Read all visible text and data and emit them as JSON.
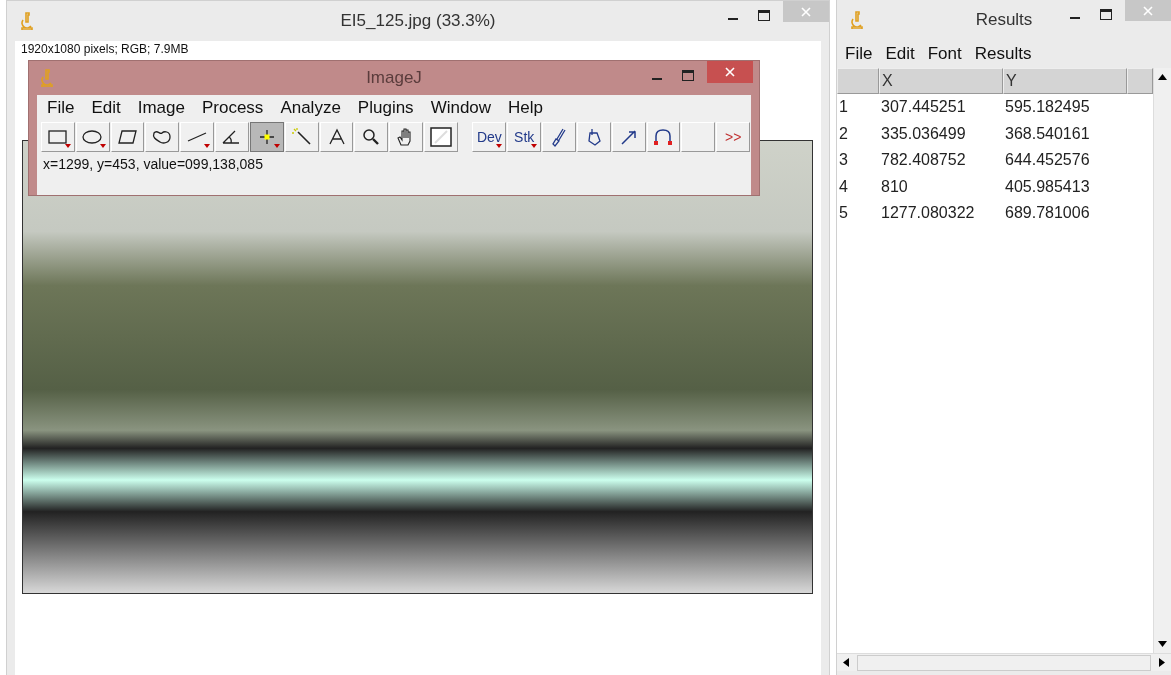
{
  "image_window": {
    "title": "EI5_125.jpg (33.3%)",
    "info": "1920x1080 pixels; RGB; 7.9MB"
  },
  "imagej": {
    "title": "ImageJ",
    "menu": [
      "File",
      "Edit",
      "Image",
      "Process",
      "Analyze",
      "Plugins",
      "Window",
      "Help"
    ],
    "tools": [
      {
        "kind": "rect",
        "selected": false,
        "menu": true
      },
      {
        "kind": "oval",
        "selected": false,
        "menu": true
      },
      {
        "kind": "polygon",
        "selected": false,
        "menu": false
      },
      {
        "kind": "freehand",
        "selected": false,
        "menu": false
      },
      {
        "kind": "line",
        "selected": false,
        "menu": true
      },
      {
        "kind": "angle",
        "selected": false,
        "menu": false
      },
      {
        "kind": "point",
        "selected": true,
        "menu": true
      },
      {
        "kind": "wand",
        "selected": false,
        "menu": false
      },
      {
        "kind": "text",
        "selected": false,
        "menu": false
      },
      {
        "kind": "zoom",
        "selected": false,
        "menu": false
      },
      {
        "kind": "hand",
        "selected": false,
        "menu": false
      },
      {
        "kind": "dropper",
        "selected": false,
        "menu": false
      },
      {
        "kind": "gap"
      },
      {
        "kind": "label",
        "label": "Dev",
        "selected": false,
        "menu": true
      },
      {
        "kind": "label",
        "label": "Stk",
        "selected": false,
        "menu": true
      },
      {
        "kind": "brush",
        "selected": false,
        "menu": false
      },
      {
        "kind": "flood",
        "selected": false,
        "menu": false
      },
      {
        "kind": "arrow",
        "selected": false,
        "menu": false
      },
      {
        "kind": "curve",
        "selected": false,
        "menu": false
      },
      {
        "kind": "blank",
        "selected": false,
        "menu": false
      },
      {
        "kind": "more",
        "label": ">>",
        "selected": false,
        "menu": false
      }
    ],
    "status": "x=1299, y=453, value=099,138,085"
  },
  "results": {
    "title": "Results",
    "menu": [
      "File",
      "Edit",
      "Font",
      "Results"
    ],
    "columns": [
      "",
      "X",
      "Y"
    ],
    "rows": [
      [
        "1",
        "307.445251",
        "595.182495"
      ],
      [
        "2",
        "335.036499",
        "368.540161"
      ],
      [
        "3",
        "782.408752",
        "644.452576"
      ],
      [
        "4",
        "810",
        "405.985413"
      ],
      [
        "5",
        "1277.080322",
        "689.781006"
      ]
    ]
  }
}
